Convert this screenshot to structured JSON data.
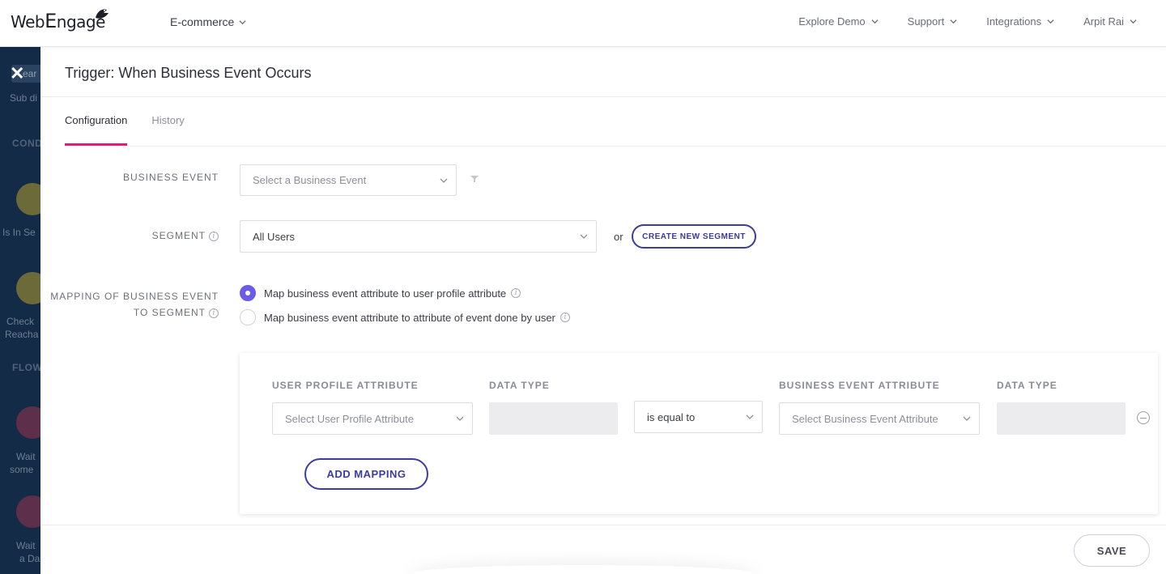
{
  "brand": {
    "logo_text_a": "Web",
    "logo_text_b": "ngage",
    "logo_e": "E"
  },
  "topbar": {
    "project": "E-commerce",
    "nav": [
      {
        "label": "Explore Demo"
      },
      {
        "label": "Support"
      },
      {
        "label": "Integrations"
      },
      {
        "label": "Arpit Rai"
      }
    ]
  },
  "bg_sidebar": {
    "search_fragment": "ear",
    "fragment_1": "Sub di",
    "section_1": "COND",
    "item_1": "Is In Se",
    "item_2a": "Check",
    "item_2b": "Reacha",
    "section_2": "FLOW",
    "item_3a": "Wait",
    "item_3b": "some",
    "item_4a": "Wait",
    "item_4b": "a Da"
  },
  "panel": {
    "title": "Trigger: When Business Event Occurs",
    "close_glyph": "✕",
    "tabs": [
      {
        "label": "Configuration",
        "active": true
      },
      {
        "label": "History",
        "active": false
      }
    ],
    "business_event": {
      "label": "BUSINESS EVENT",
      "placeholder": "Select a Business Event"
    },
    "segment": {
      "label": "SEGMENT",
      "value": "All Users",
      "or": "or",
      "create_label": "CREATE NEW SEGMENT"
    },
    "mapping": {
      "label_line1": "MAPPING OF BUSINESS EVENT",
      "label_line2": "TO SEGMENT",
      "options": [
        {
          "label": "Map business event attribute to user profile attribute",
          "selected": true
        },
        {
          "label": "Map business event attribute to attribute of event done by user",
          "selected": false
        }
      ]
    },
    "mapping_table": {
      "headers": [
        "USER PROFILE ATTRIBUTE",
        "DATA TYPE",
        "BUSINESS EVENT ATTRIBUTE",
        "DATA TYPE"
      ],
      "user_attr_placeholder": "Select User Profile Attribute",
      "operator": "is equal to",
      "event_attr_placeholder": "Select Business Event Attribute",
      "add_label": "ADD MAPPING"
    },
    "save_label": "SAVE"
  },
  "colors": {
    "accent_tab": "#e6197a",
    "primary": "#3c3b9e",
    "radio": "#6b5ce7",
    "sidebar_bg": "#132b46"
  },
  "icons": [
    "chevron-down-icon",
    "filter-icon",
    "info-icon",
    "minus-circle-icon",
    "close-icon",
    "logo-bird-icon"
  ]
}
